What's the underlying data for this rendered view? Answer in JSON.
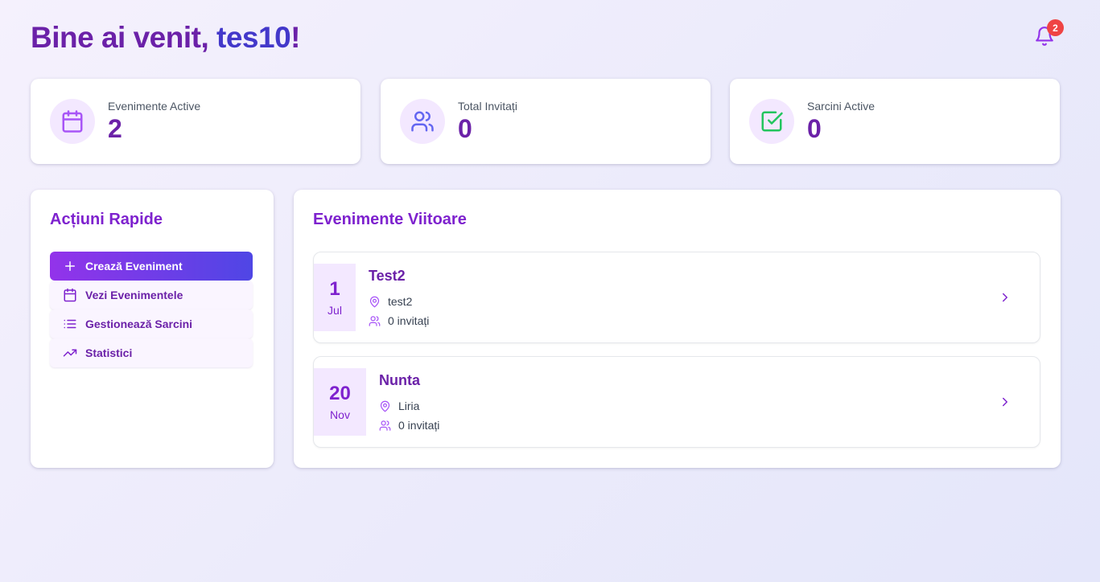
{
  "header": {
    "greeting_prefix": "Bine ai venit, ",
    "username": "tes10",
    "greeting_suffix": "!",
    "notification_count": "2",
    "icon": "bell-icon"
  },
  "stats": [
    {
      "label": "Evenimente Active",
      "value": "2",
      "icon": "calendar-icon",
      "icon_color": "#a855f7"
    },
    {
      "label": "Total Invitați",
      "value": "0",
      "icon": "users-icon",
      "icon_color": "#6366f1"
    },
    {
      "label": "Sarcini Active",
      "value": "0",
      "icon": "check-square-icon",
      "icon_color": "#22c55e"
    }
  ],
  "quick_actions": {
    "title": "Acțiuni Rapide",
    "items": [
      {
        "label": "Crează Eveniment",
        "icon": "plus-icon"
      },
      {
        "label": "Vezi Evenimentele",
        "icon": "calendar-icon"
      },
      {
        "label": "Gestionează Sarcini",
        "icon": "list-icon"
      },
      {
        "label": "Statistici",
        "icon": "trending-up-icon"
      }
    ]
  },
  "upcoming": {
    "title": "Evenimente Viitoare",
    "events": [
      {
        "day": "1",
        "month": "Jul",
        "name": "Test2",
        "location": "test2",
        "guests": "0 invitați"
      },
      {
        "day": "20",
        "month": "Nov",
        "name": "Nunta",
        "location": "Liria",
        "guests": "0 invitați"
      }
    ]
  },
  "colors": {
    "primary_purple": "#7e22ce",
    "indigo": "#4338ca",
    "badge_red": "#ef4444",
    "light_purple": "#f3e8ff"
  }
}
